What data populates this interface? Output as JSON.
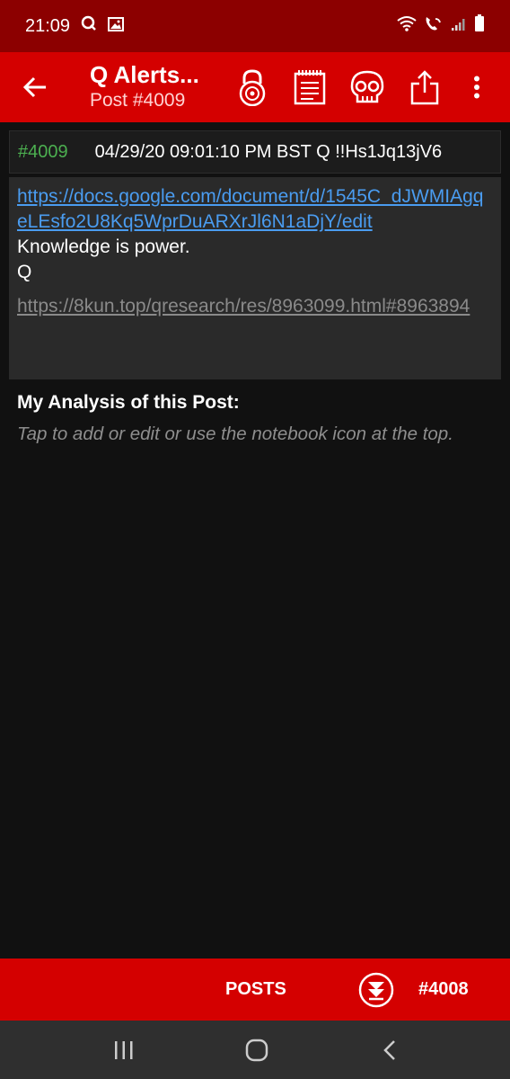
{
  "status_bar": {
    "time": "21:09",
    "icons_left": [
      "q-notification-icon",
      "image-notification-icon"
    ],
    "icons_right": [
      "wifi-icon",
      "wifi-calling-icon",
      "signal-icon",
      "battery-icon"
    ]
  },
  "app_bar": {
    "title": "Q Alerts...",
    "subtitle": "Post #4009",
    "actions": [
      "back-arrow-icon",
      "lock-icon",
      "notebook-icon",
      "skull-icon",
      "share-icon",
      "more-vert-icon"
    ]
  },
  "post": {
    "number": "#4009",
    "meta": "04/29/20 09:01:10 PM BST Q !!Hs1Jq13jV6",
    "body_link": "https://docs.google.com/document/d/1545C_dJWMIAgqeLEsfo2U8Kq5WprDuARXrJl6N1aDjY/edit",
    "text_line_1": "Knowledge is power.",
    "text_line_2": "Q",
    "source_link": "https://8kun.top/qresearch/res/8963099.html#8963894"
  },
  "analysis": {
    "title": "My Analysis of this Post:",
    "hint": "Tap to add or edit or use the notebook icon at the top."
  },
  "bottom_bar": {
    "posts_label": "POSTS",
    "prev_label": "#4008"
  },
  "nav_bar": {
    "buttons": [
      "recents-icon",
      "home-icon",
      "back-icon"
    ]
  },
  "colors": {
    "status_bar": "#8c0000",
    "app_bar": "#d40000",
    "background": "#111111",
    "post_number": "#4caf50",
    "link": "#4a9cf0",
    "muted_link": "#8a8a8a"
  }
}
